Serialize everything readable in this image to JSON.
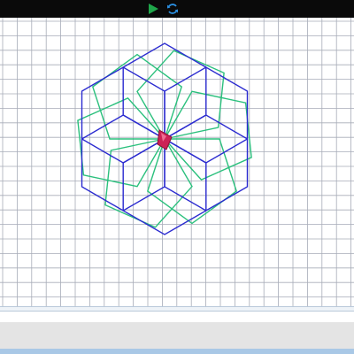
{
  "toolbar": {
    "run_icon": "play-triangle-icon",
    "reset_icon": "circular-arrows-icon",
    "run_color": "#1fa64a",
    "reset_color": "#2b8fe0"
  },
  "canvas": {
    "background": "#ffffff",
    "grid_color": "#a7acb8",
    "shapes": {
      "hexagon_color": "#2b2bd0",
      "pentagon_color": "#2bc07d"
    },
    "turtle": {
      "icon": "turtle-cursor-icon",
      "color": "#cc2255"
    }
  }
}
